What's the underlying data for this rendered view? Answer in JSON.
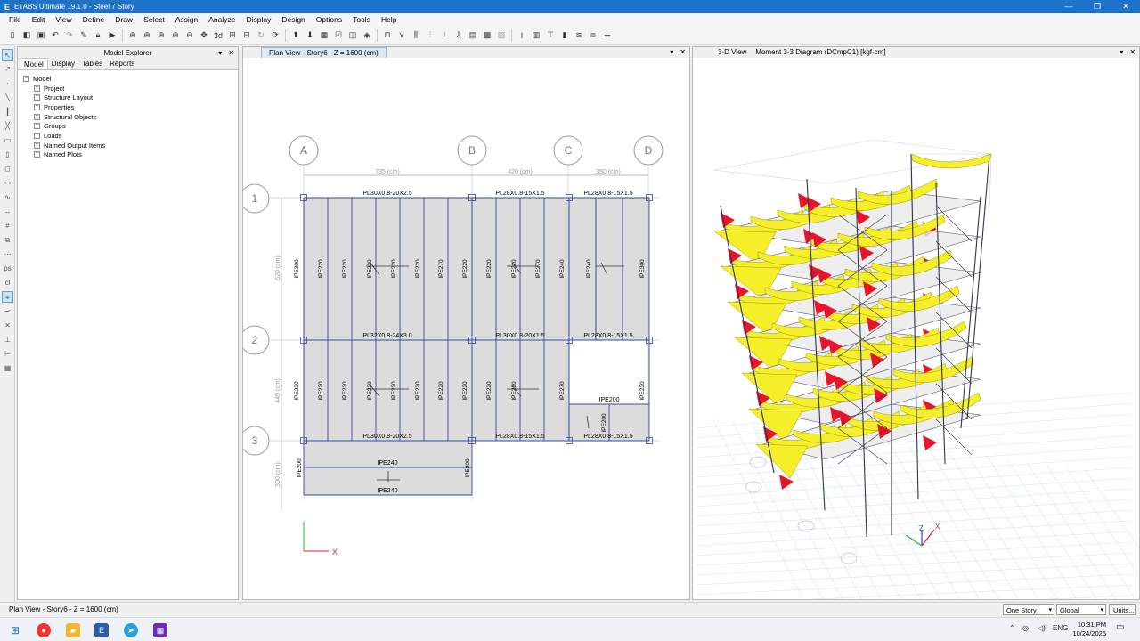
{
  "window": {
    "title": "ETABS Ultimate 19.1.0 - Steel 7 Story",
    "app_letter": "E",
    "min": "—",
    "max": "❐",
    "close": "✕"
  },
  "menu": [
    "File",
    "Edit",
    "View",
    "Define",
    "Draw",
    "Select",
    "Assign",
    "Analyze",
    "Display",
    "Design",
    "Options",
    "Tools",
    "Help"
  ],
  "explorer": {
    "title": "Model Explorer",
    "tabs": [
      "Model",
      "Display",
      "Tables",
      "Reports"
    ],
    "root": "Model",
    "items": [
      "Project",
      "Structure Layout",
      "Properties",
      "Structural Objects",
      "Groups",
      "Loads",
      "Named Output Items",
      "Named Plots"
    ]
  },
  "plan": {
    "tab_title": "Plan View - Story6 - Z = 1600 (cm)",
    "grid_letters": [
      "A",
      "B",
      "C",
      "D"
    ],
    "grid_numbers": [
      "1",
      "2",
      "3"
    ],
    "dims_x": [
      "735 (cm)",
      "420 (cm)",
      "350 (cm)"
    ],
    "dims_y": [
      "620 (cm)",
      "440 (cm)",
      "300 (cm)"
    ],
    "girders": {
      "r1": [
        "PL30X0.8-20X2.5",
        "PL28X0.8-15X1.5",
        "PL28X0.8-15X1.5"
      ],
      "r2": [
        "PL32X0.8-24X3.0",
        "PL30X0.8-20X1.5",
        "PL28X0.8-15X1.5"
      ],
      "r3": [
        "PL30X0.8-20X2.5",
        "PL28X0.8-15X1.5",
        "PL28X0.8-15X1.5"
      ]
    },
    "beams_top": [
      "IPE300",
      "IPE220",
      "IPE220",
      "IPE220",
      "IPE220",
      "IPE220",
      "IPE270",
      "IPE220",
      "IPE220",
      "IPE220",
      "IPE270",
      "IPE240",
      "IPE240",
      "IPE300"
    ],
    "beams_mid": [
      "IPE220",
      "IPE220",
      "IPE220",
      "IPE220",
      "IPE220",
      "IPE220",
      "IPE220",
      "IPE220",
      "IPE220",
      "IPE220",
      "IPE270",
      "IPE220"
    ],
    "ipe200_h": "IPE200",
    "ipe200_v": "IPE200",
    "canti": {
      "top": "IPE240",
      "bottom": "IPE240",
      "left": "IPE200",
      "right": "IPE200"
    },
    "axis_x": "X"
  },
  "view3d": {
    "tab_label": "3-D View",
    "tab_title": "Moment 3-3 Diagram   (DCmpC1)  [kgf-cm]",
    "axis_x": "X",
    "axis_z": "Z"
  },
  "status": {
    "text": "Plan View - Story6 - Z = 1600 (cm)",
    "story_select": "One Story",
    "coord_select": "Global",
    "units_button": "Units..."
  },
  "taskbar": {
    "lang": "ENG",
    "time": "10:31 PM",
    "date": "10/24/2025"
  }
}
